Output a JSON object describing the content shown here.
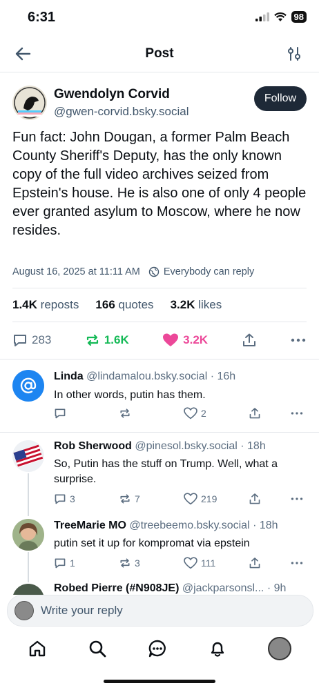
{
  "status_bar": {
    "time": "6:31",
    "battery": "98"
  },
  "nav": {
    "title": "Post"
  },
  "post": {
    "author_name": "Gwendolyn Corvid",
    "author_handle": "@gwen-corvid.bsky.social",
    "follow_label": "Follow",
    "text": "Fun fact: John Dougan, a former Palm Beach County Sheriff's Deputy, has the only known copy of the full video archives seized from Epstein's house. He is also one of only 4 people ever granted asylum to Moscow, where he now resides.",
    "timestamp": "August 16, 2025 at 11:11 AM",
    "reply_setting": "Everybody can reply",
    "stats": {
      "reposts_count": "1.4K",
      "reposts_label": "reposts",
      "quotes_count": "166",
      "quotes_label": "quotes",
      "likes_count": "3.2K",
      "likes_label": "likes"
    },
    "actions": {
      "replies": "283",
      "reposts": "1.6K",
      "likes": "3.2K"
    },
    "colors": {
      "repost_active": "#13b955",
      "like_active": "#ec4899",
      "follow_bg": "#1e2937"
    }
  },
  "replies": [
    {
      "name": "Linda",
      "handle": "@lindamalou.bsky.social",
      "time": "· 16h",
      "text": "In other words, putin has them.",
      "replies": "",
      "reposts": "",
      "likes": "2"
    },
    {
      "name": "Rob Sherwood",
      "handle": "@pinesol.bsky.social",
      "time": "· 18h",
      "text": "So, Putin has the stuff on Trump.  Well, what a surprise.",
      "replies": "3",
      "reposts": "7",
      "likes": "219"
    },
    {
      "name": "TreeMarie MO",
      "handle": "@treebeemo.bsky.social",
      "time": "· 18h",
      "text": "putin set it up for kompromat via epstein",
      "replies": "1",
      "reposts": "3",
      "likes": "111"
    },
    {
      "name": "Robed Pierre (#N908JE)",
      "handle": "@jackparsonsl...",
      "time": "· 9h"
    }
  ],
  "composer": {
    "placeholder": "Write your reply"
  },
  "tabbar": {
    "icons": [
      "home-icon",
      "search-icon",
      "chat-icon",
      "bell-icon",
      "profile-avatar"
    ]
  }
}
